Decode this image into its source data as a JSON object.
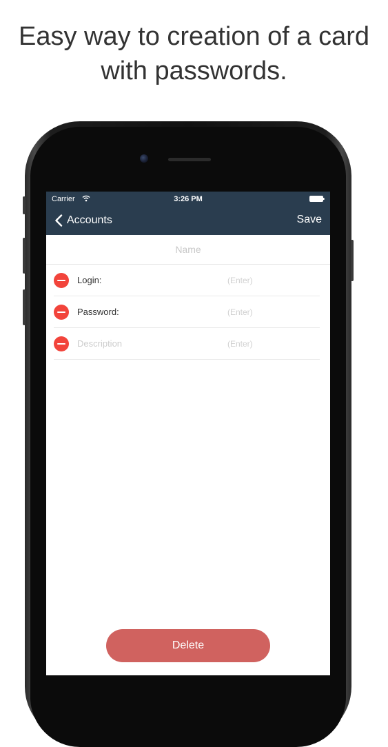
{
  "headline": {
    "line1": "Easy way to creation of a card",
    "line2": "with passwords."
  },
  "status_bar": {
    "carrier": "Carrier",
    "time": "3:26 PM",
    "icons": [
      "wifi-icon",
      "battery-icon"
    ]
  },
  "nav": {
    "back_label": "Accounts",
    "back_icon": "chevron-left-icon",
    "save_label": "Save",
    "bar_color": "#2a3d4f"
  },
  "name_field": {
    "placeholder": "Name",
    "value": ""
  },
  "fields": [
    {
      "label": "Login:",
      "placeholder": "(Enter)",
      "value": ""
    },
    {
      "label": "Password:",
      "placeholder": "(Enter)",
      "value": ""
    },
    {
      "label": "Description",
      "placeholder": "(Enter)",
      "value": ""
    }
  ],
  "delete_button": {
    "label": "Delete",
    "color": "#d0625f"
  },
  "colors": {
    "remove_icon": "#f2443b"
  }
}
